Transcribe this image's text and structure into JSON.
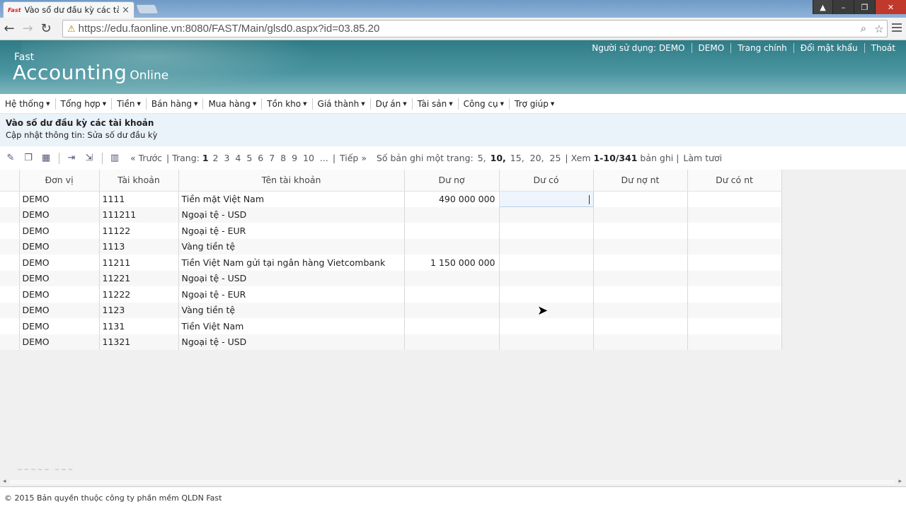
{
  "browser": {
    "tab_favicon": "Fast",
    "tab_title": "Vào sổ dư đầu kỳ các tài k",
    "url": "https://edu.faonline.vn:8080/FAST/Main/glsd0.aspx?id=03.85.20"
  },
  "header": {
    "logo_fast": "Fast",
    "logo_accounting": "Accounting",
    "logo_online": "Online",
    "user_links": [
      "Người sử dụng: DEMO",
      "DEMO",
      "Trang chính",
      "Đổi mật khẩu",
      "Thoát"
    ]
  },
  "menu": [
    "Hệ thống",
    "Tổng hợp",
    "Tiền",
    "Bán hàng",
    "Mua hàng",
    "Tồn kho",
    "Giá thành",
    "Dự án",
    "Tài sản",
    "Công cụ",
    "Trợ giúp"
  ],
  "page": {
    "title": "Vào số dư đầu kỳ các tài khoản",
    "subtitle": "Cập nhật thông tin: Sửa số dư đầu kỳ"
  },
  "pager": {
    "prev": "« Trước",
    "pages_label": "Trang:",
    "pages": [
      "1",
      "2",
      "3",
      "4",
      "5",
      "6",
      "7",
      "8",
      "9",
      "10",
      "..."
    ],
    "next": "Tiếp »",
    "page_size_label": "Số bản ghi một trang:",
    "page_sizes": [
      "5,",
      "10,",
      "15,",
      "20,",
      "25"
    ],
    "view_label": "Xem",
    "range": "1-10/341",
    "records_label": "bản ghi",
    "refresh": "Làm tươi"
  },
  "grid": {
    "columns": [
      "",
      "Đơn vị",
      "Tài khoản",
      "Tên tài khoản",
      "Dư nợ",
      "Dư có",
      "Dư nợ nt",
      "Dư có nt"
    ],
    "rows": [
      [
        "DEMO",
        "1111",
        "Tiền mặt Việt Nam",
        "490 000 000",
        "",
        "",
        ""
      ],
      [
        "DEMO",
        "111211",
        "Ngoại tệ - USD",
        "",
        "",
        "",
        ""
      ],
      [
        "DEMO",
        "11122",
        "Ngoại tệ - EUR",
        "",
        "",
        "",
        ""
      ],
      [
        "DEMO",
        "1113",
        "Vàng tiền tệ",
        "",
        "",
        "",
        ""
      ],
      [
        "DEMO",
        "11211",
        "Tiền Việt Nam gửi tại ngân hàng Vietcombank",
        "1 150 000 000",
        "",
        "",
        ""
      ],
      [
        "DEMO",
        "11221",
        "Ngoại tệ - USD",
        "",
        "",
        "",
        ""
      ],
      [
        "DEMO",
        "11222",
        "Ngoại tệ - EUR",
        "",
        "",
        "",
        ""
      ],
      [
        "DEMO",
        "1123",
        "Vàng tiền tệ",
        "",
        "",
        "",
        ""
      ],
      [
        "DEMO",
        "1131",
        "Tiền Việt Nam",
        "",
        "",
        "",
        ""
      ],
      [
        "DEMO",
        "11321",
        "Ngoại tệ - USD",
        "",
        "",
        "",
        ""
      ]
    ]
  },
  "footer": "© 2015 Bản quyền thuộc công ty phần mềm QLDN Fast"
}
